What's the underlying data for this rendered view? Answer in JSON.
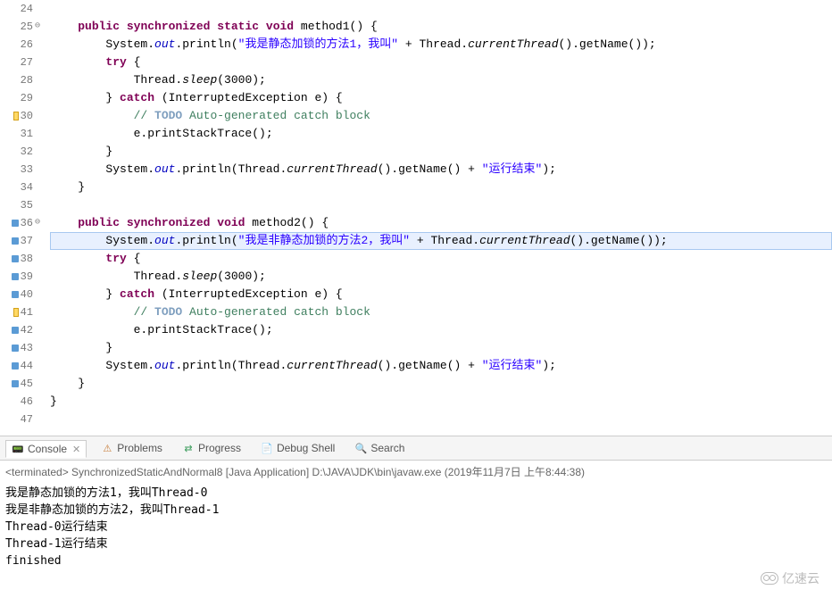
{
  "editor": {
    "lines": [
      {
        "num": "24",
        "html": ""
      },
      {
        "num": "25",
        "fold": "⊖",
        "html": "    <span class='kw'>public</span> <span class='kw'>synchronized</span> <span class='kw'>static</span> <span class='kw'>void</span> method1() {"
      },
      {
        "num": "26",
        "html": "        System.<span class='field'>out</span>.println(<span class='string'>\"我是静态加锁的方法1，我叫\"</span> + Thread.<span class='method-i'>currentThread</span>().getName());"
      },
      {
        "num": "27",
        "html": "        <span class='kw'>try</span> {"
      },
      {
        "num": "28",
        "html": "            Thread.<span class='method-i'>sleep</span>(3000);"
      },
      {
        "num": "29",
        "html": "        } <span class='kw'>catch</span> (InterruptedException e) {"
      },
      {
        "num": "30",
        "marker": "yellow",
        "html": "            <span class='comment'>// <span class='todo'>TODO</span> Auto-generated catch block</span>"
      },
      {
        "num": "31",
        "html": "            e.printStackTrace();"
      },
      {
        "num": "32",
        "html": "        }"
      },
      {
        "num": "33",
        "html": "        System.<span class='field'>out</span>.println(Thread.<span class='method-i'>currentThread</span>().getName() + <span class='string'>\"运行结束\"</span>);"
      },
      {
        "num": "34",
        "html": "    }"
      },
      {
        "num": "35",
        "html": ""
      },
      {
        "num": "36",
        "fold": "⊖",
        "marker": "blue",
        "html": "    <span class='kw'>public</span> <span class='kw'>synchronized</span> <span class='kw'>void</span> method2() {"
      },
      {
        "num": "37",
        "marker": "blue",
        "highlight": true,
        "html": "        System.<span class='field'>out</span>.println(<span class='string'>\"我是非静态加锁的方法2，我叫\"</span> + Thread.<span class='method-i'>currentThread</span>().getName());"
      },
      {
        "num": "38",
        "marker": "blue",
        "html": "        <span class='kw'>try</span> {"
      },
      {
        "num": "39",
        "marker": "blue",
        "html": "            Thread.<span class='method-i'>sleep</span>(3000);"
      },
      {
        "num": "40",
        "marker": "blue",
        "html": "        } <span class='kw'>catch</span> (InterruptedException e) {"
      },
      {
        "num": "41",
        "marker": "yellow",
        "html": "            <span class='comment'>// <span class='todo'>TODO</span> Auto-generated catch block</span>"
      },
      {
        "num": "42",
        "marker": "blue",
        "html": "            e.printStackTrace();"
      },
      {
        "num": "43",
        "marker": "blue",
        "html": "        }"
      },
      {
        "num": "44",
        "marker": "blue",
        "html": "        System.<span class='field'>out</span>.println(Thread.<span class='method-i'>currentThread</span>().getName() + <span class='string'>\"运行结束\"</span>);"
      },
      {
        "num": "45",
        "marker": "blue",
        "html": "    }"
      },
      {
        "num": "46",
        "html": "}"
      },
      {
        "num": "47",
        "html": ""
      }
    ]
  },
  "tabs": {
    "items": [
      {
        "icon": "📟",
        "iconColor": "#5b7ba8",
        "label": "Console",
        "active": true,
        "closable": true
      },
      {
        "icon": "⚠",
        "iconColor": "#c77d3a",
        "label": "Problems"
      },
      {
        "icon": "⇄",
        "iconColor": "#3a9c5c",
        "label": "Progress"
      },
      {
        "icon": "📄",
        "iconColor": "#5b7ba8",
        "label": "Debug Shell"
      },
      {
        "icon": "🔍",
        "iconColor": "#c9a33a",
        "label": "Search"
      }
    ]
  },
  "console": {
    "header": "<terminated> SynchronizedStaticAndNormal8 [Java Application] D:\\JAVA\\JDK\\bin\\javaw.exe (2019年11月7日 上午8:44:38)",
    "output": [
      "我是静态加锁的方法1，我叫Thread-0",
      "我是非静态加锁的方法2，我叫Thread-1",
      "Thread-0运行结束",
      "Thread-1运行结束",
      "finished"
    ]
  },
  "watermark": {
    "text": "亿速云"
  }
}
